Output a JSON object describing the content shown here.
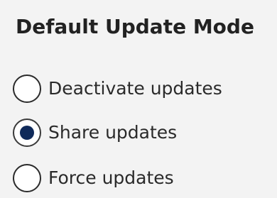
{
  "section": {
    "title": "Default Update Mode"
  },
  "options": [
    {
      "label": "Deactivate updates",
      "selected": false
    },
    {
      "label": "Share updates",
      "selected": true
    },
    {
      "label": "Force updates",
      "selected": false
    }
  ],
  "colors": {
    "background": "#f3f3f3",
    "radio_fill": "#0f2a5a",
    "radio_border": "#2b2b2b"
  }
}
